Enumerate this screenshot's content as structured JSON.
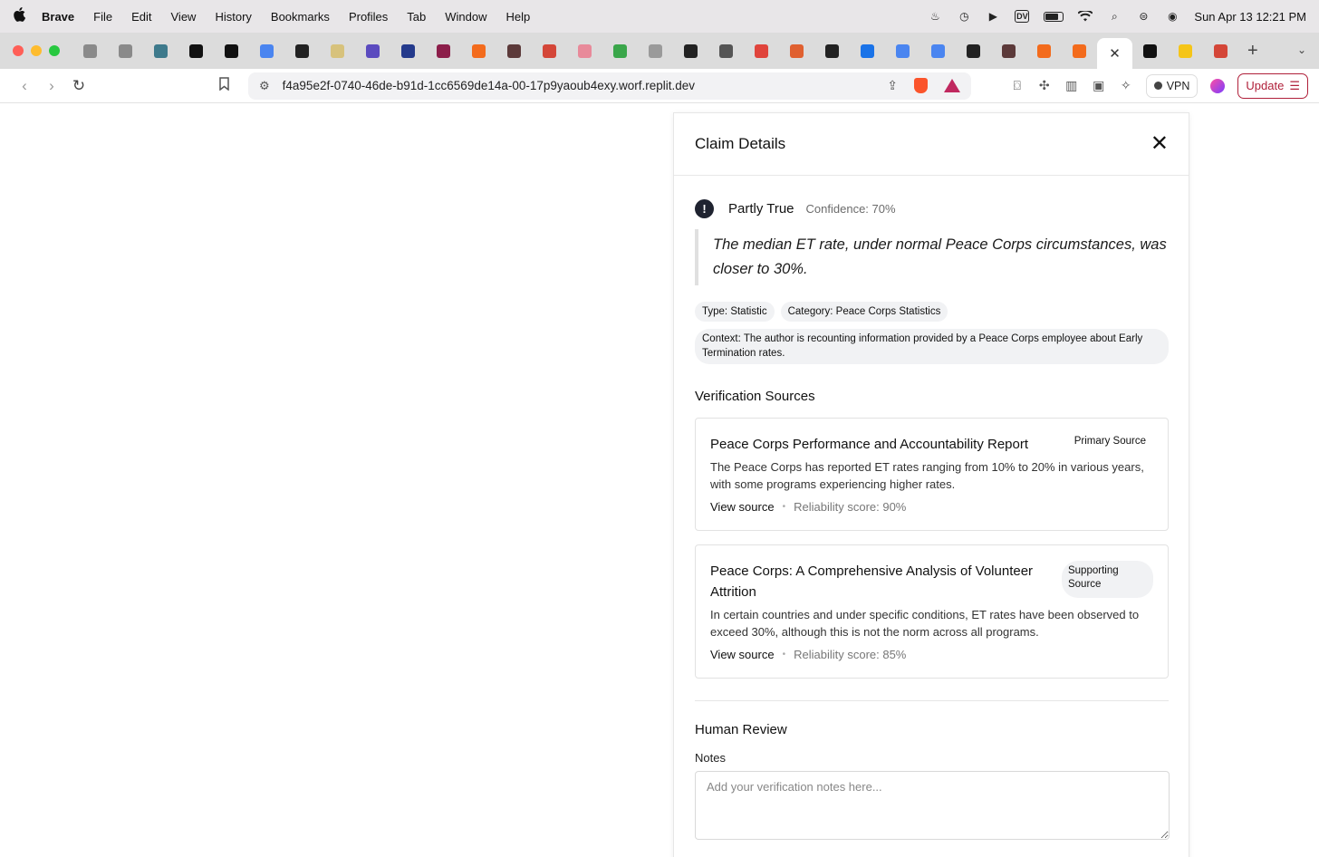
{
  "menubar": {
    "app": "Brave",
    "items": [
      "File",
      "Edit",
      "View",
      "History",
      "Bookmarks",
      "Profiles",
      "Tab",
      "Window",
      "Help"
    ],
    "clock": "Sun Apr 13  12:21 PM",
    "dv_badge": "DV"
  },
  "tabs": {
    "favicon_colors": [
      "#8a8a8a",
      "#8a8a8a",
      "#3e7a8c",
      "#111111",
      "#111111",
      "#4a85f0",
      "#222222",
      "#d7c27c",
      "#5b4bbf",
      "#243a8c",
      "#8c1e4a",
      "#f36b1c",
      "#5c3a3a",
      "#d44638",
      "#e88a9a",
      "#3aa64a",
      "#9a9a9a",
      "#222222",
      "#555555",
      "#e0443c",
      "#e06030",
      "#222222",
      "#1a73e8",
      "#4a85f0",
      "#4a85f0",
      "#222222",
      "#5c3a3a",
      "#f36b1c",
      "#f36b1c"
    ],
    "after_active_colors": [
      "#111111",
      "#f5c518",
      "#d44638"
    ],
    "active_close": "✕",
    "new_tab": "+",
    "menu": "⌄"
  },
  "toolbar": {
    "url": "f4a95e2f-0740-46de-b91d-1cc6569de14a-00-17p9yaoub4exy.worf.replit.dev",
    "vpn_label": "VPN",
    "update_label": "Update"
  },
  "claim": {
    "panel_title": "Claim Details",
    "close_glyph": "✕",
    "verdict": "Partly True",
    "confidence": "Confidence: 70%",
    "quote": "The median ET rate, under normal Peace Corps circumstances, was closer to 30%.",
    "type_chip": "Type: Statistic",
    "category_chip": "Category: Peace Corps Statistics",
    "context": "Context: The author is recounting information provided by a Peace Corps employee about Early Termination rates."
  },
  "sources": {
    "section_title": "Verification Sources",
    "items": [
      {
        "title": "Peace Corps Performance and Accountability Report",
        "badge": "Primary Source",
        "description": "The Peace Corps has reported ET rates ranging from 10% to 20% in various years, with some programs experiencing higher rates.",
        "link": "View source",
        "reliability": "Reliability score: 90%"
      },
      {
        "title": "Peace Corps: A Comprehensive Analysis of Volunteer Attrition",
        "badge": "Supporting Source",
        "description": "In certain countries and under specific conditions, ET rates have been observed to exceed 30%, although this is not the norm across all programs.",
        "link": "View source",
        "reliability": "Reliability score: 85%"
      }
    ]
  },
  "review": {
    "section_title": "Human Review",
    "notes_label": "Notes",
    "notes_placeholder": "Add your verification notes here...",
    "notes_value": ""
  }
}
